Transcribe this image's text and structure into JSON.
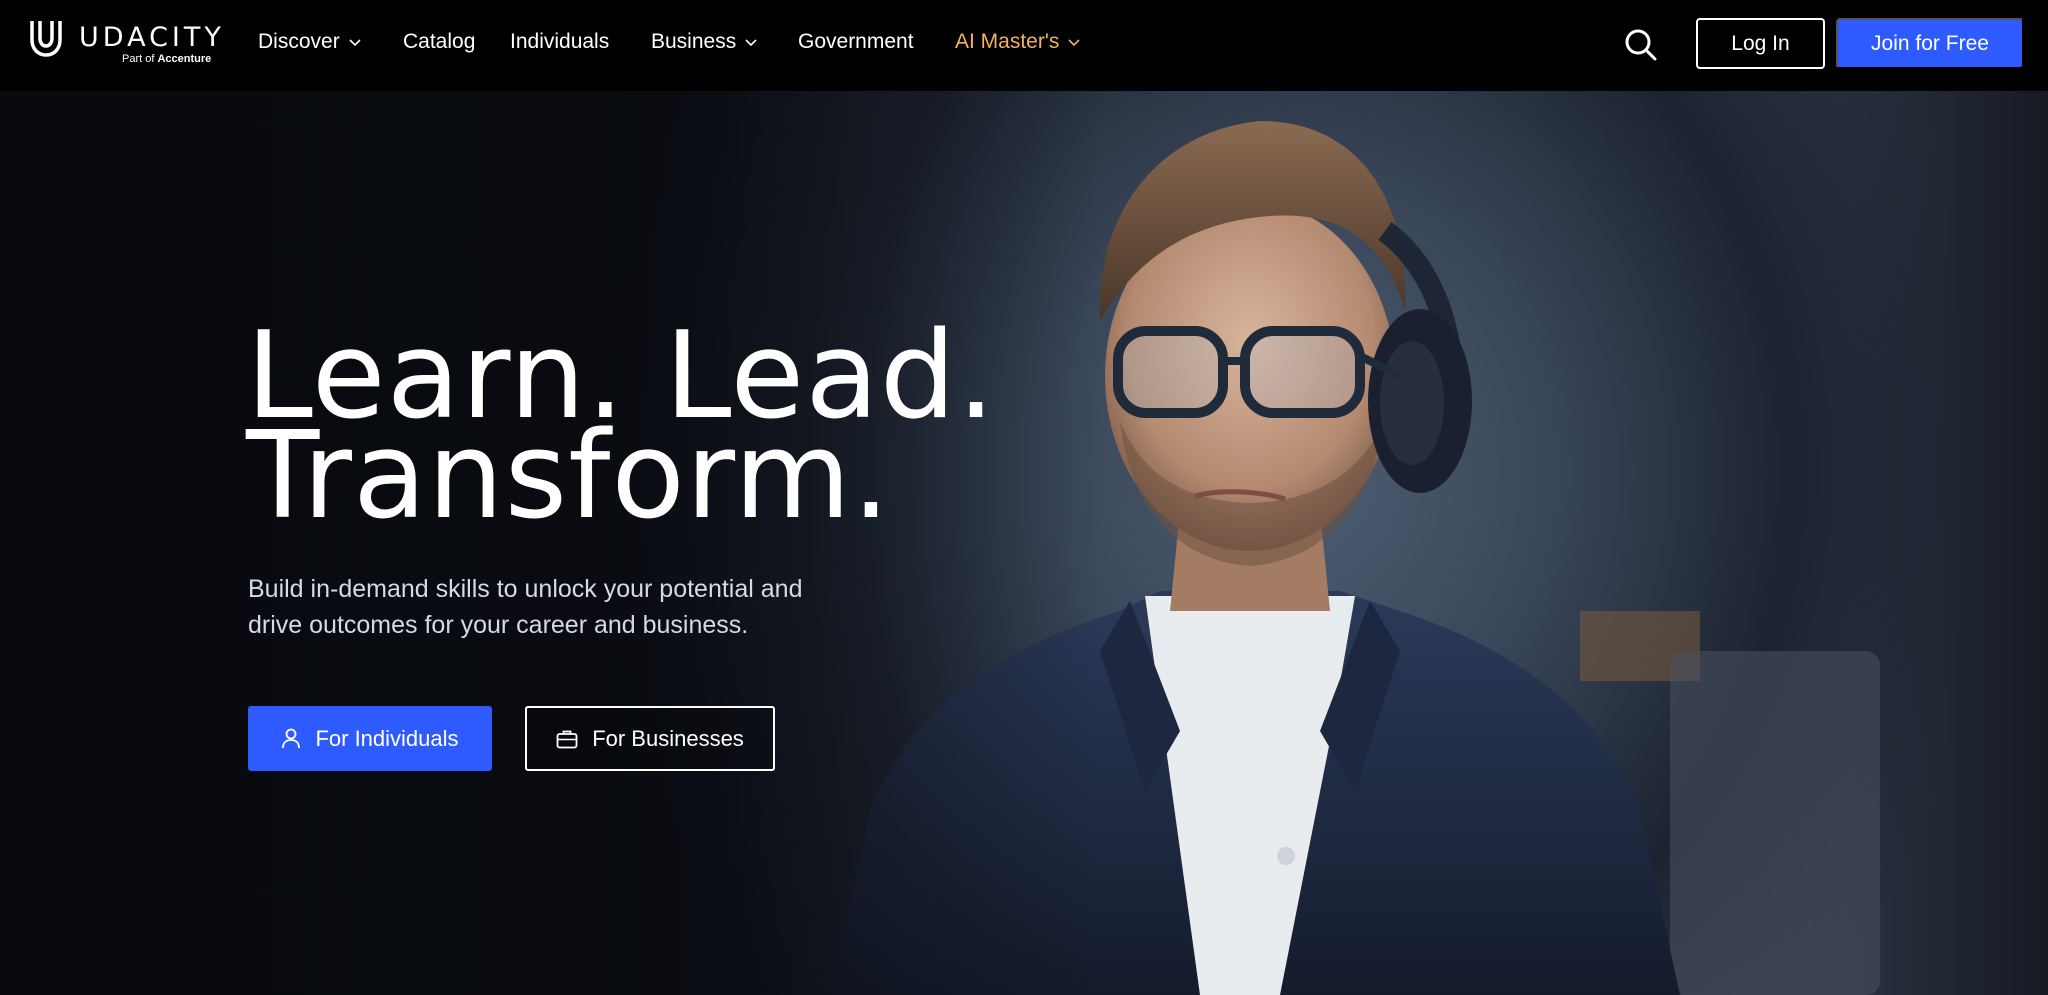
{
  "brand": {
    "name": "UDACITY",
    "sub_prefix": "Part of",
    "sub_company": "Accenture"
  },
  "nav": {
    "items": [
      {
        "label": "Discover",
        "has_menu": true
      },
      {
        "label": "Catalog",
        "has_menu": false
      },
      {
        "label": "Individuals",
        "has_menu": false
      },
      {
        "label": "Business",
        "has_menu": true
      },
      {
        "label": "Government",
        "has_menu": false
      },
      {
        "label": "AI Master's",
        "has_menu": true,
        "accent": "#f0b35b"
      }
    ],
    "login_label": "Log In",
    "join_label": "Join for Free"
  },
  "hero": {
    "headline_line1": "Learn. Lead.",
    "headline_line2": "Transform.",
    "subtitle": "Build in-demand skills to unlock your potential and drive outcomes for your career and business.",
    "cta_individuals": "For Individuals",
    "cta_businesses": "For Businesses"
  },
  "colors": {
    "primary": "#2e5bff",
    "accent": "#f0b35b",
    "nav_bg": "#000000"
  }
}
